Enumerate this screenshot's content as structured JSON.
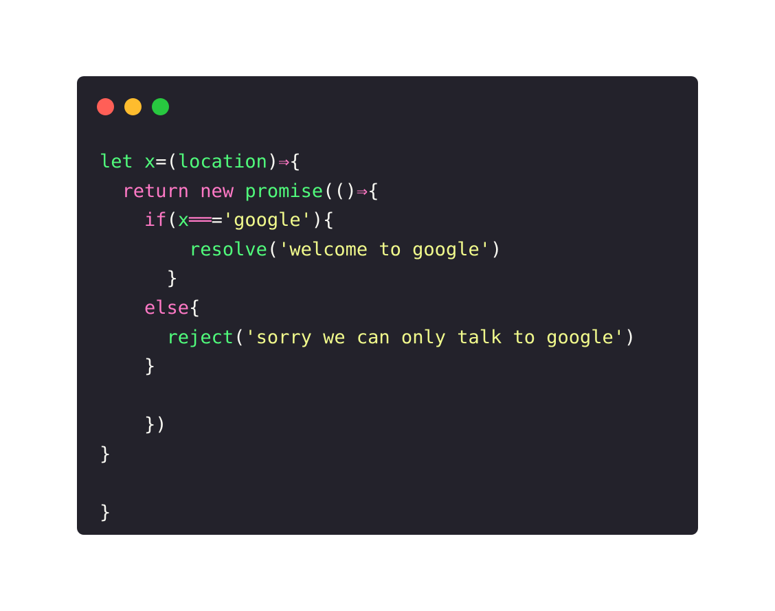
{
  "window": {
    "controls": [
      {
        "name": "close-dot-icon",
        "color": "#ff5f57"
      },
      {
        "name": "minimize-dot-icon",
        "color": "#febc2e"
      },
      {
        "name": "maximize-dot-icon",
        "color": "#28c840"
      }
    ]
  },
  "colors": {
    "keyword": "#ff79c6",
    "function": "#50fa7b",
    "string": "#f1fa8c",
    "punctuation": "#f8f8f2",
    "background": "#23222b"
  },
  "code_lines": [
    [
      {
        "t": "let x",
        "c": "function"
      },
      {
        "t": "=",
        "c": "punctuation"
      },
      {
        "t": "(",
        "c": "punctuation"
      },
      {
        "t": "location",
        "c": "function"
      },
      {
        "t": ")",
        "c": "punctuation"
      },
      {
        "t": "⇒",
        "c": "keyword"
      },
      {
        "t": "{",
        "c": "punctuation"
      }
    ],
    [
      {
        "t": "  ",
        "c": "punctuation"
      },
      {
        "t": "return new",
        "c": "keyword"
      },
      {
        "t": " ",
        "c": "punctuation"
      },
      {
        "t": "promise",
        "c": "function"
      },
      {
        "t": "(()",
        "c": "punctuation"
      },
      {
        "t": "⇒",
        "c": "keyword"
      },
      {
        "t": "{",
        "c": "punctuation"
      }
    ],
    [
      {
        "t": "    ",
        "c": "punctuation"
      },
      {
        "t": "if",
        "c": "keyword"
      },
      {
        "t": "(",
        "c": "punctuation"
      },
      {
        "t": "x",
        "c": "function"
      },
      {
        "t": "══",
        "c": "keyword"
      },
      {
        "t": "=",
        "c": "punctuation"
      },
      {
        "t": "'google'",
        "c": "string"
      },
      {
        "t": "){",
        "c": "punctuation"
      }
    ],
    [
      {
        "t": "        ",
        "c": "punctuation"
      },
      {
        "t": "resolve",
        "c": "function"
      },
      {
        "t": "(",
        "c": "punctuation"
      },
      {
        "t": "'welcome to google'",
        "c": "string"
      },
      {
        "t": ")",
        "c": "punctuation"
      }
    ],
    [
      {
        "t": "      }",
        "c": "punctuation"
      }
    ],
    [
      {
        "t": "    ",
        "c": "punctuation"
      },
      {
        "t": "else",
        "c": "keyword"
      },
      {
        "t": "{",
        "c": "punctuation"
      }
    ],
    [
      {
        "t": "      ",
        "c": "punctuation"
      },
      {
        "t": "reject",
        "c": "function"
      },
      {
        "t": "(",
        "c": "punctuation"
      },
      {
        "t": "'sorry we can only talk to google'",
        "c": "string"
      },
      {
        "t": ")",
        "c": "punctuation"
      }
    ],
    [
      {
        "t": "    }",
        "c": "punctuation"
      }
    ],
    [
      {
        "t": "",
        "c": "punctuation"
      }
    ],
    [
      {
        "t": "    })",
        "c": "punctuation"
      }
    ],
    [
      {
        "t": "}",
        "c": "punctuation"
      }
    ],
    [
      {
        "t": "",
        "c": "punctuation"
      }
    ],
    [
      {
        "t": "}",
        "c": "punctuation"
      }
    ]
  ]
}
